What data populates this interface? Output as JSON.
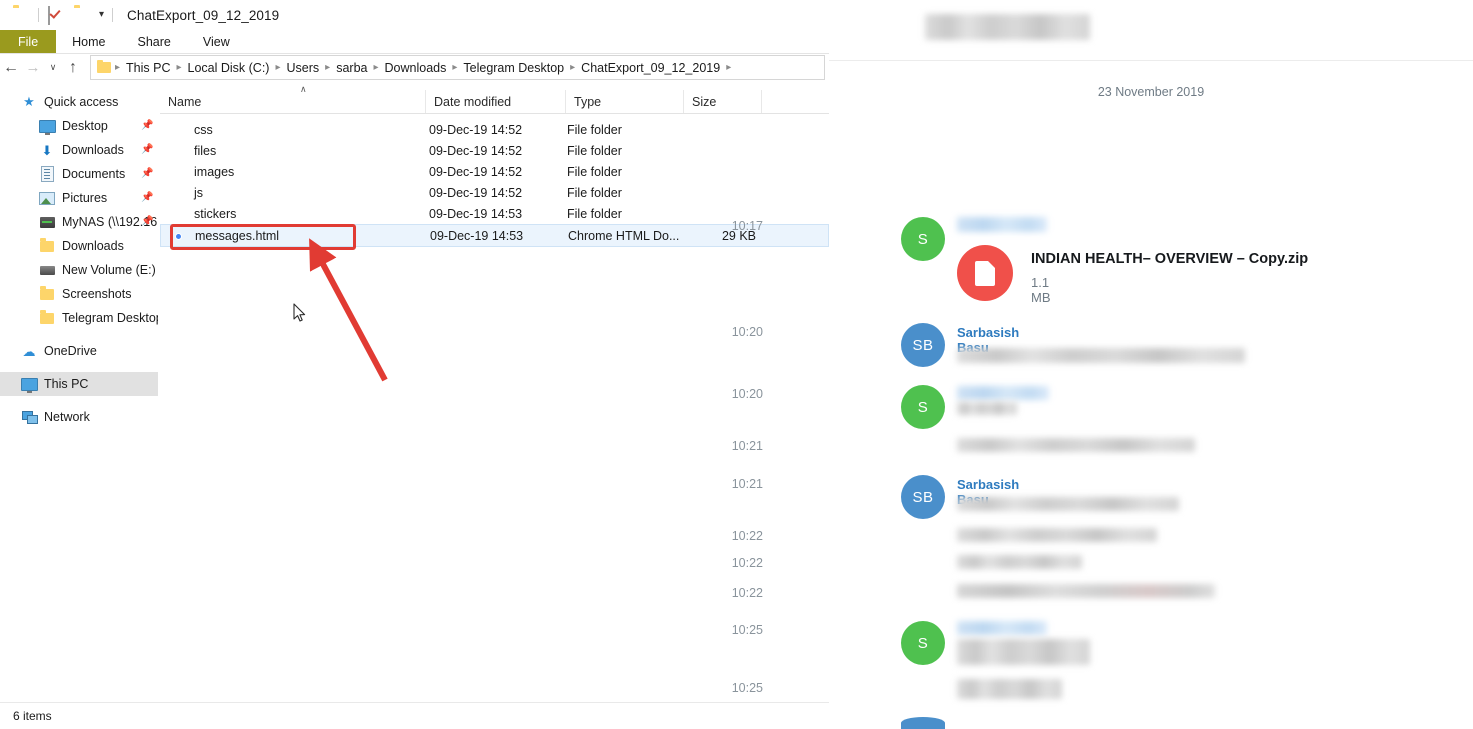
{
  "window": {
    "title": "ChatExport_09_12_2019",
    "quick_access_icons": [
      "folder-icon",
      "properties-check-icon",
      "new-folder-icon",
      "customize-caret-icon"
    ],
    "ribbon_tabs": [
      {
        "label": "File",
        "active": true
      },
      {
        "label": "Home",
        "active": false
      },
      {
        "label": "Share",
        "active": false
      },
      {
        "label": "View",
        "active": false
      }
    ],
    "nav_buttons": {
      "back": "←",
      "forward": "→",
      "recent": "∨",
      "up": "↑"
    },
    "breadcrumb": [
      "This PC",
      "Local Disk (C:)",
      "Users",
      "sarba",
      "Downloads",
      "Telegram Desktop",
      "ChatExport_09_12_2019"
    ],
    "status": "6 items"
  },
  "columns": {
    "name": "Name",
    "date_modified": "Date modified",
    "type": "Type",
    "size": "Size",
    "sort_indicator": "∧"
  },
  "sidebar": {
    "groups": [
      {
        "label": "Quick access",
        "icon": "star-icon",
        "items": [
          {
            "label": "Desktop",
            "icon": "monitor-icon",
            "pinned": true
          },
          {
            "label": "Downloads",
            "icon": "download-arrow-icon",
            "pinned": true
          },
          {
            "label": "Documents",
            "icon": "document-icon",
            "pinned": true
          },
          {
            "label": "Pictures",
            "icon": "picture-icon",
            "pinned": true
          },
          {
            "label": "MyNAS (\\\\192.16",
            "icon": "nas-icon",
            "pinned": true
          },
          {
            "label": "Downloads",
            "icon": "folder-icon",
            "pinned": false
          },
          {
            "label": "New Volume (E:)",
            "icon": "drive-icon",
            "pinned": false
          },
          {
            "label": "Screenshots",
            "icon": "folder-icon",
            "pinned": false
          },
          {
            "label": "Telegram Desktop",
            "icon": "folder-icon",
            "pinned": false
          }
        ]
      }
    ],
    "roots": [
      {
        "label": "OneDrive",
        "icon": "cloud-icon",
        "selected": false
      },
      {
        "label": "This PC",
        "icon": "monitor-icon",
        "selected": true
      },
      {
        "label": "Network",
        "icon": "network-icon",
        "selected": false
      }
    ]
  },
  "files": [
    {
      "name": "css",
      "icon": "folder-icon",
      "date": "09-Dec-19 14:52",
      "type": "File folder",
      "size": "",
      "selected": false
    },
    {
      "name": "files",
      "icon": "folder-icon",
      "date": "09-Dec-19 14:52",
      "type": "File folder",
      "size": "",
      "selected": false
    },
    {
      "name": "images",
      "icon": "folder-icon",
      "date": "09-Dec-19 14:52",
      "type": "File folder",
      "size": "",
      "selected": false
    },
    {
      "name": "js",
      "icon": "folder-icon",
      "date": "09-Dec-19 14:52",
      "type": "File folder",
      "size": "",
      "selected": false
    },
    {
      "name": "stickers",
      "icon": "folder-icon",
      "date": "09-Dec-19 14:53",
      "type": "File folder",
      "size": "",
      "selected": false
    },
    {
      "name": "messages.html",
      "icon": "chrome-icon",
      "date": "09-Dec-19 14:53",
      "type": "Chrome HTML Do...",
      "size": "29 KB",
      "selected": true
    }
  ],
  "annotation": {
    "highlight_color": "#e13b33",
    "arrow_color": "#e13b33",
    "target": "messages.html"
  },
  "telegram": {
    "date_separator": "23 November 2019",
    "avatar_colors": {
      "green": "#4FC14F",
      "blue": "#4A8FCB"
    },
    "sender_name_color": "#2e7bbf",
    "attachment": {
      "filename": "INDIAN HEALTH– OVERVIEW – Copy.zip",
      "filesize": "1.1 MB",
      "icon": "zip-file-icon",
      "icon_color": "#f0504a"
    },
    "messages": [
      {
        "avatar": "S",
        "avatar_color": "green",
        "sender_redacted": true,
        "time": "10:17",
        "has_attachment": true
      },
      {
        "avatar": "SB",
        "avatar_color": "blue",
        "sender": "Sarbasish Basu",
        "time": "10:20"
      },
      {
        "avatar": "S",
        "avatar_color": "green",
        "sender_redacted": true,
        "time": "10:20"
      },
      {
        "avatar": "",
        "time": "10:21"
      },
      {
        "avatar": "SB",
        "avatar_color": "blue",
        "sender": "Sarbasish Basu",
        "time": "10:21"
      },
      {
        "avatar": "",
        "time": "10:22"
      },
      {
        "avatar": "",
        "time": "10:22"
      },
      {
        "avatar": "",
        "time": "10:22"
      },
      {
        "avatar": "S",
        "avatar_color": "green",
        "sender_redacted": true,
        "time": "10:25"
      },
      {
        "avatar": "",
        "time": "10:25"
      }
    ]
  }
}
